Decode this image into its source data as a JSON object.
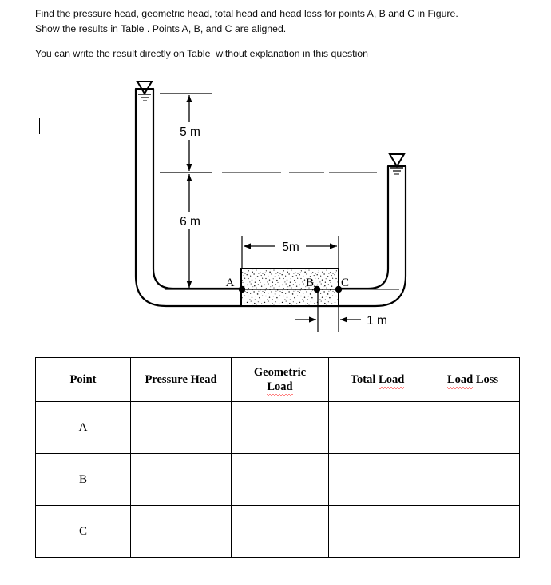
{
  "question": {
    "line1": "Find the pressure head, geometric head, total head and head loss for points A, B and C in Figure.",
    "line2": "Show the results in Table . Points A, B, and C are aligned.",
    "line3": "You can write the result directly on Table  without explanation in this question"
  },
  "figure": {
    "dim_vertical_top": "5 m",
    "dim_vertical_bottom": "6 m",
    "dim_horizontal_sample": "5m",
    "dim_horizontal_right": "1 m",
    "point_a": "A",
    "point_b": "B",
    "point_c": "C",
    "left_standpipe_symbol": "water-level-triangle",
    "right_standpipe_symbol": "water-level-triangle",
    "soil_fill": "stippled-sand",
    "line_color": "#000000"
  },
  "table": {
    "headers": [
      "Point",
      "Pressure Head",
      "Geometric Load",
      "Total Load",
      "Load Loss"
    ],
    "header_parts": {
      "geometric_word1": "Geometric",
      "geometric_word2": "Load",
      "total_word1": "Total ",
      "total_word2": "Load",
      "loss_word1": "Load",
      "loss_word2": " Loss"
    },
    "rows": [
      {
        "point": "A",
        "pressure_head": "",
        "geometric_load": "",
        "total_load": "",
        "load_loss": ""
      },
      {
        "point": "B",
        "pressure_head": "",
        "geometric_load": "",
        "total_load": "",
        "load_loss": ""
      },
      {
        "point": "C",
        "pressure_head": "",
        "geometric_load": "",
        "total_load": "",
        "load_loss": ""
      }
    ]
  }
}
